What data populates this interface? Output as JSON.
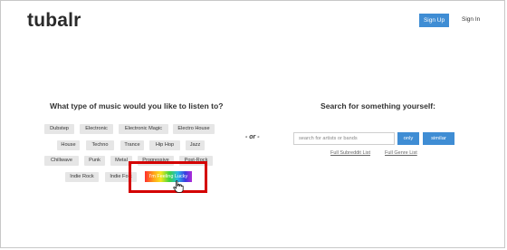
{
  "header": {
    "logo": "tubalr",
    "signup_label": "Sign Up",
    "signin_label": "Sign In"
  },
  "genres": {
    "heading": "What type of music would you like to listen to?",
    "tags": [
      "Dubstep",
      "Electronic",
      "Electronic Magic",
      "Electro House",
      "House",
      "Techno",
      "Trance",
      "Hip Hop",
      "Jazz",
      "Chillwave",
      "Punk",
      "Metal",
      "Progressive",
      "Post-Rock",
      "Indie Rock",
      "Indie Folk"
    ],
    "lucky_label": "I'm Feeling Lucky"
  },
  "divider": {
    "label": "- or -"
  },
  "search": {
    "heading": "Search for something yourself:",
    "placeholder": "search for artists or bands",
    "only_label": "only",
    "similar_label": "similar",
    "subreddit_link": "Full Subreddit List",
    "genre_link": "Full Genre List"
  },
  "colors": {
    "accent": "#3f8dd4",
    "highlight": "#d40000",
    "tag_bg": "#e6e6e6"
  },
  "icons": {
    "cursor": "hand-pointer-icon"
  }
}
